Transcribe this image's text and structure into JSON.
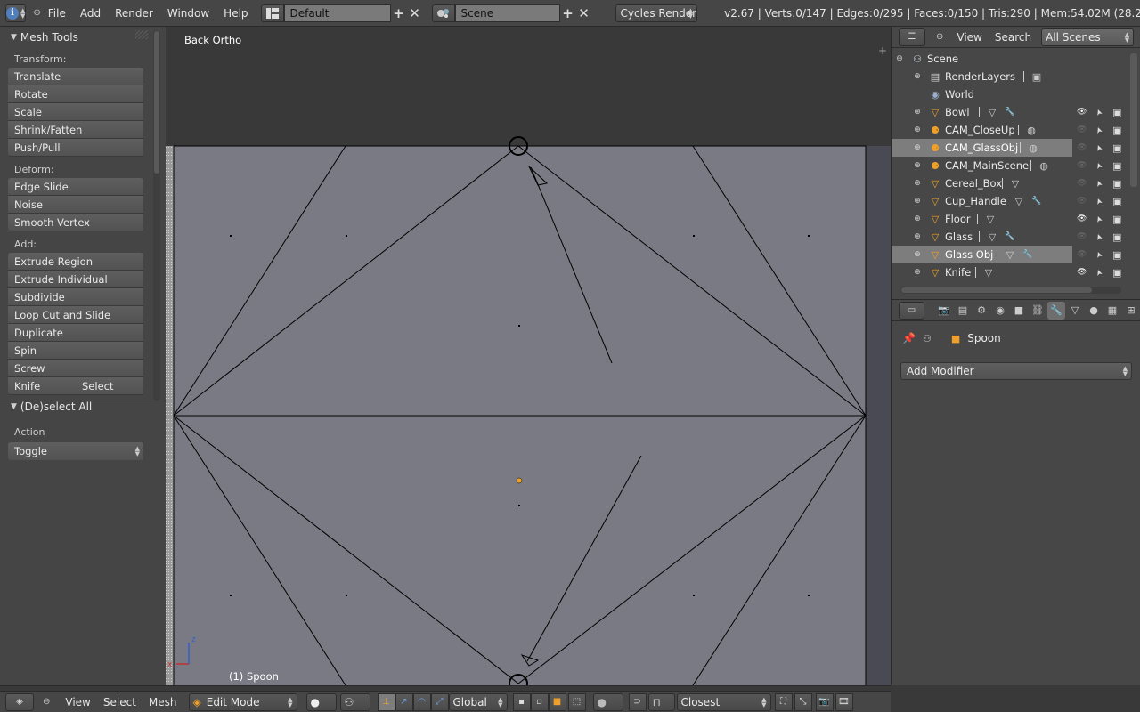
{
  "topbar": {
    "menus": [
      "File",
      "Add",
      "Render",
      "Window",
      "Help"
    ],
    "layout": "Default",
    "scene": "Scene",
    "render_engine": "Cycles Render",
    "stats": "v2.67 | Verts:0/147 | Edges:0/295 | Faces:0/150 | Tris:290 | Mem:54.02M (28.23M) | Sp"
  },
  "toolshelf": {
    "title": "Mesh Tools",
    "transform_label": "Transform:",
    "transform": [
      "Translate",
      "Rotate",
      "Scale",
      "Shrink/Fatten",
      "Push/Pull"
    ],
    "deform_label": "Deform:",
    "deform": [
      "Edge Slide",
      "Noise",
      "Smooth Vertex"
    ],
    "add_label": "Add:",
    "add": [
      "Extrude Region",
      "Extrude Individual",
      "Subdivide",
      "Loop Cut and Slide",
      "Duplicate",
      "Spin",
      "Screw"
    ],
    "knife": "Knife",
    "select": "Select"
  },
  "operator": {
    "title": "(De)select All",
    "action_label": "Action",
    "action_value": "Toggle"
  },
  "viewport": {
    "view_name": "Back Ortho",
    "object_label": "(1) Spoon"
  },
  "outliner": {
    "menus": [
      "View",
      "Search"
    ],
    "filter": "All Scenes",
    "items": [
      {
        "name": "Scene",
        "type": "scene"
      },
      {
        "name": "RenderLayers",
        "type": "renderlayers"
      },
      {
        "name": "World",
        "type": "world"
      },
      {
        "name": "Bowl",
        "type": "mesh"
      },
      {
        "name": "CAM_CloseUp",
        "type": "camera"
      },
      {
        "name": "CAM_GlassObj",
        "type": "camera",
        "selected": true
      },
      {
        "name": "CAM_MainScene",
        "type": "camera"
      },
      {
        "name": "Cereal_Box",
        "type": "mesh"
      },
      {
        "name": "Cup_Handle",
        "type": "mesh"
      },
      {
        "name": "Floor",
        "type": "mesh"
      },
      {
        "name": "Glass",
        "type": "mesh"
      },
      {
        "name": "Glass Obj",
        "type": "mesh",
        "selected": true
      },
      {
        "name": "Knife",
        "type": "mesh"
      }
    ]
  },
  "properties": {
    "object_name": "Spoon",
    "add_modifier": "Add Modifier"
  },
  "bottombar": {
    "menus": [
      "View",
      "Select",
      "Mesh"
    ],
    "mode": "Edit Mode",
    "orientation": "Global",
    "snap_target": "Closest"
  },
  "colors": {
    "accent_orange": "#f0a028",
    "blue_icon": "#4f7fbf",
    "selected_row": "#7d7d7d"
  }
}
